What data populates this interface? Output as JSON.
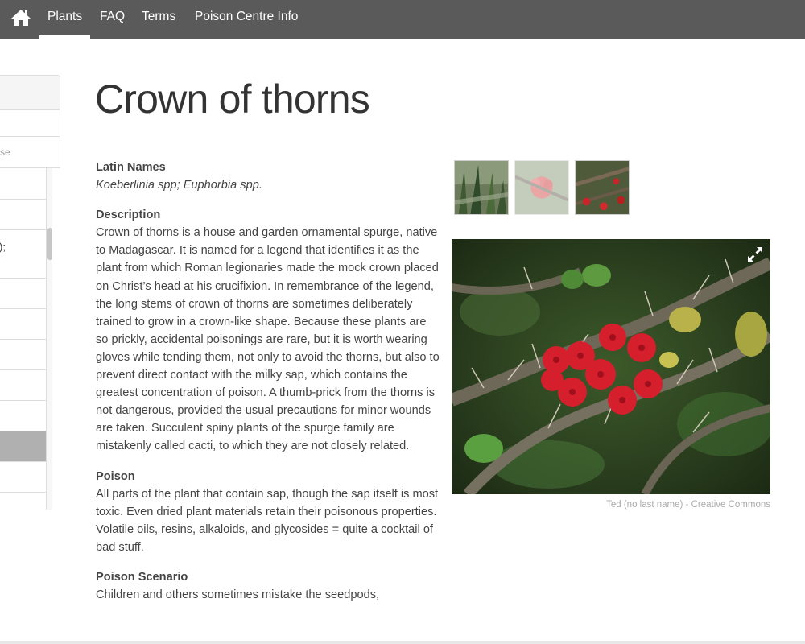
{
  "nav": {
    "items": [
      {
        "label": "Plants",
        "active": true
      },
      {
        "label": "FAQ",
        "active": false
      },
      {
        "label": "Terms",
        "active": false
      },
      {
        "label": "Poison Centre Info",
        "active": false
      }
    ]
  },
  "sidebar": {
    "search_fragment": "se",
    "items": [
      {
        "label": ""
      },
      {
        "label": ""
      },
      {
        "label": ");"
      },
      {
        "label": ""
      },
      {
        "label": ""
      },
      {
        "label": ""
      },
      {
        "label": ""
      },
      {
        "label": ""
      },
      {
        "label": "",
        "active": true
      },
      {
        "label": ""
      }
    ]
  },
  "plant": {
    "title": "Crown of thorns",
    "latin_label": "Latin Names",
    "latin_value": "Koeberlinia spp; Euphorbia spp.",
    "description_label": "Description",
    "description_text": "Crown of thorns is a house and garden ornamental spurge, native to Madagascar. It is named for a legend that identifies it as the plant from which Roman legionaries made the mock crown placed on Christ’s head at his crucifixion. In remembrance of the legend, the long stems of crown of thorns are sometimes deliberately trained to grow in a crown-like shape. Because these plants are so prickly, accidental poisonings are rare, but it is worth wearing gloves while tending them, not only to avoid the thorns, but also to prevent direct contact with the milky sap, which contains the greatest concentration of poison. A thumb-prick from the thorns is not dangerous, provided the usual precautions for minor wounds are taken. Succulent spiny plants of the spurge family are mistakenly called cacti, to which they are not closely related.",
    "poison_label": "Poison",
    "poison_text": "All parts of the plant that contain sap, though the sap itself is most toxic. Even dried plant materials retain their poisonous properties. Volatile oils, resins, alkaloids, and glycosides = quite a cocktail of bad stuff.",
    "scenario_label": "Poison Scenario",
    "scenario_text": "Children and others sometimes mistake the seedpods,"
  },
  "gallery": {
    "credit": "Ted (no last name) - Creative Commons"
  },
  "colors": {
    "navbar": "#5a5a5a",
    "flower_red": "#d61f2c",
    "credit_text": "#aaaaaa"
  }
}
